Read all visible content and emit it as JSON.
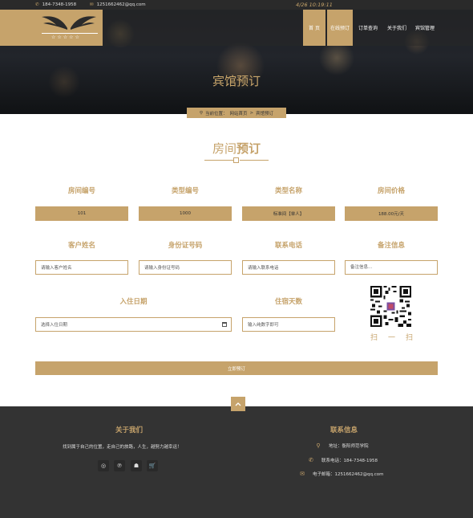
{
  "topbar": {
    "phone": "184-7348-1958",
    "email": "1251662462@qq.com",
    "time": "4/26 10:19:11"
  },
  "logo": {
    "stars": "☆☆☆☆☆"
  },
  "nav": {
    "items": [
      "首 页",
      "在线预订",
      "订单查询",
      "关于我们",
      "宾馆管理"
    ],
    "active": 1
  },
  "hero": {
    "title": "宾馆预订"
  },
  "breadcrumb": {
    "prefix": "当前位置：",
    "home": "网站首页",
    "sep": ">",
    "current": "宾馆预订"
  },
  "section": {
    "title_light": "房间",
    "title_bold": "预订"
  },
  "form": {
    "room_no_label": "房间编号",
    "room_no_value": "101",
    "type_no_label": "类型编号",
    "type_no_value": "1000",
    "type_name_label": "类型名称",
    "type_name_value": "标准间【单人】",
    "price_label": "房间价格",
    "price_value": "188.00元/天",
    "customer_label": "客户姓名",
    "customer_placeholder": "请输入客户姓名",
    "idcard_label": "身份证号码",
    "idcard_placeholder": "请输入身份证号码",
    "phone_label": "联系电话",
    "phone_placeholder": "请输入联系电话",
    "remark_label": "备注信息",
    "remark_placeholder": "备注信息...",
    "checkin_label": "入住日期",
    "checkin_placeholder": "选择入住日期",
    "days_label": "住宿天数",
    "days_placeholder": "输入纯数字即可",
    "submit_label": "立即预订"
  },
  "scan": {
    "chars": [
      "扫",
      "一",
      "扫"
    ]
  },
  "footer": {
    "about_title": "关于我们",
    "about_text": "找到属于自己的位置，走自己的旅路，人生，越努力越幸运！",
    "contact_title": "联系信息",
    "address": "地址：衡阳师范学院",
    "phone": "联系电话：184-7348-1958",
    "email": "电子邮箱：1251662462@qq.com"
  },
  "colors": {
    "accent": "#c6a36b",
    "footer_bg": "#333333",
    "topbar_bg": "#2a2a2a"
  }
}
